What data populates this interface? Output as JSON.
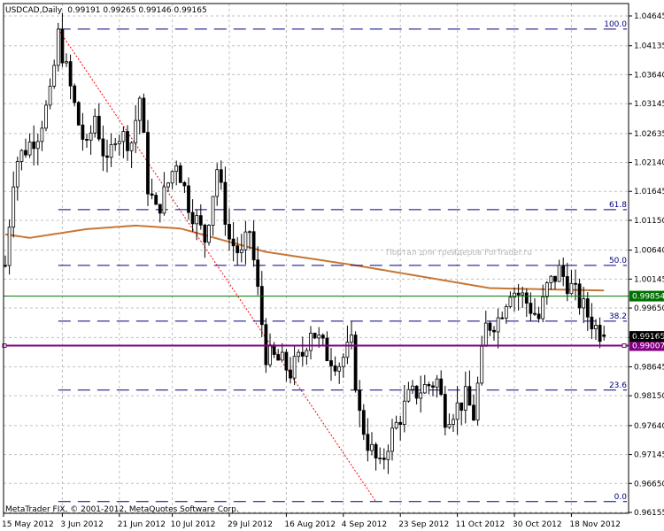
{
  "header": {
    "symbol": "USDCAD,Daily",
    "ohlc": "0.99191 0.99265 0.99146 0.99165"
  },
  "footer": {
    "copyright": "MetaTrader FIX, © 2001-2012, MetaQuotes Software Corp."
  },
  "watermark": "Портал для трейдеров ForTrader.ru",
  "colors": {
    "candle": "#000000",
    "ma": "#c87533",
    "fib": "#000080",
    "trend": "#ff0000",
    "green_line": "#007000",
    "purple_line": "#800080",
    "grid": "#c0c0c0"
  },
  "chart_data": {
    "type": "candlestick",
    "title": "USDCAD,Daily",
    "ylim": [
      0.96155,
      1.04645
    ],
    "y_ticks": [
      "1.04645",
      "1.04135",
      "1.03640",
      "1.03145",
      "1.02635",
      "1.02140",
      "1.01645",
      "1.01150",
      "1.00640",
      "1.00145",
      "0.99650",
      "0.99145",
      "0.98645",
      "0.98150",
      "0.97640",
      "0.97145",
      "0.96650",
      "0.96155"
    ],
    "x_ticks": [
      {
        "label": "15 May 2012",
        "bar": 0
      },
      {
        "label": "3 Jun 2012",
        "bar": 14
      },
      {
        "label": "21 Jun 2012",
        "bar": 28
      },
      {
        "label": "10 Jul 2012",
        "bar": 41
      },
      {
        "label": "29 Jul 2012",
        "bar": 55
      },
      {
        "label": "16 Aug 2012",
        "bar": 69
      },
      {
        "label": "4 Sep 2012",
        "bar": 83
      },
      {
        "label": "23 Sep 2012",
        "bar": 97
      },
      {
        "label": "11 Oct 2012",
        "bar": 111
      },
      {
        "label": "30 Oct 2012",
        "bar": 125
      },
      {
        "label": "18 Nov 2012",
        "bar": 139
      }
    ],
    "bars": 148,
    "approx_close_path": [
      [
        0,
        1.0038
      ],
      [
        2,
        1.0189
      ],
      [
        3,
        1.0219
      ],
      [
        8,
        1.0265
      ],
      [
        11,
        1.0325
      ],
      [
        13,
        1.0431
      ],
      [
        15,
        1.0371
      ],
      [
        18,
        1.028
      ],
      [
        20,
        1.0234
      ],
      [
        22,
        1.0295
      ],
      [
        25,
        1.0204
      ],
      [
        27,
        1.0265
      ],
      [
        31,
        1.025
      ],
      [
        33,
        1.0325
      ],
      [
        35,
        1.0174
      ],
      [
        37,
        1.0129
      ],
      [
        39,
        1.0159
      ],
      [
        42,
        1.0219
      ],
      [
        45,
        1.0144
      ],
      [
        49,
        1.0083
      ],
      [
        52,
        1.0204
      ],
      [
        55,
        1.0083
      ],
      [
        58,
        1.0053
      ],
      [
        60,
        1.0098
      ],
      [
        62,
        0.9992
      ],
      [
        64,
        0.9886
      ],
      [
        68,
        0.9871
      ],
      [
        70,
        0.9856
      ],
      [
        73,
        0.9886
      ],
      [
        75,
        0.9932
      ],
      [
        79,
        0.9886
      ],
      [
        82,
        0.9871
      ],
      [
        85,
        0.9901
      ],
      [
        87,
        0.9781
      ],
      [
        89,
        0.9735
      ],
      [
        92,
        0.969
      ],
      [
        94,
        0.9735
      ],
      [
        96,
        0.9765
      ],
      [
        99,
        0.9811
      ],
      [
        102,
        0.9826
      ],
      [
        106,
        0.9841
      ],
      [
        108,
        0.9781
      ],
      [
        111,
        0.9796
      ],
      [
        113,
        0.9811
      ],
      [
        115,
        0.9781
      ],
      [
        118,
        0.9932
      ],
      [
        121,
        0.9947
      ],
      [
        124,
        0.9999
      ],
      [
        127,
        0.9984
      ],
      [
        131,
        0.9947
      ],
      [
        133,
        0.9999
      ],
      [
        136,
        1.0029
      ],
      [
        139,
        0.9999
      ],
      [
        143,
        0.9953
      ],
      [
        145,
        0.9932
      ],
      [
        147,
        0.99165
      ]
    ],
    "moving_average": [
      [
        0,
        1.0091
      ],
      [
        6,
        1.0085
      ],
      [
        20,
        1.01
      ],
      [
        32,
        1.0106
      ],
      [
        43,
        1.0101
      ],
      [
        64,
        1.0061
      ],
      [
        86,
        1.0038
      ],
      [
        119,
        0.9999
      ],
      [
        147,
        0.9995
      ]
    ],
    "fibonacci": {
      "from_bar": 13,
      "to_bar": 91,
      "high": 1.0442,
      "low": 0.9634,
      "levels": [
        {
          "label": "100.0",
          "ratio": 1
        },
        {
          "label": "61.8",
          "ratio": 0.618
        },
        {
          "label": "50.0",
          "ratio": 0.5
        },
        {
          "label": "38.2",
          "ratio": 0.382
        },
        {
          "label": "23.6",
          "ratio": 0.236
        },
        {
          "label": "0.0",
          "ratio": 0
        }
      ]
    },
    "horizontal_lines": [
      {
        "label": "0.99854",
        "price": 0.99854,
        "color": "#007000"
      },
      {
        "label": "0.99007",
        "price": 0.99007,
        "color": "#800080"
      }
    ],
    "current_price": {
      "label": "0.99165",
      "price": 0.99165
    }
  }
}
